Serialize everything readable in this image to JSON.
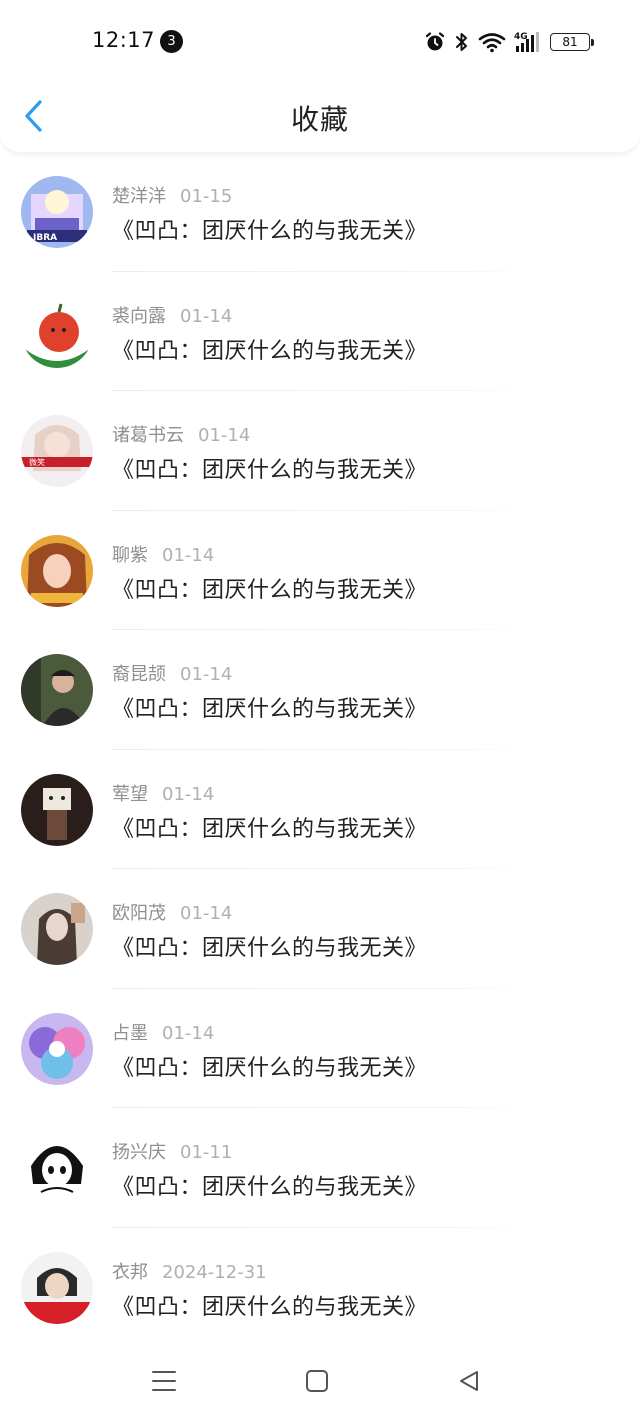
{
  "status_bar": {
    "time": "12:17",
    "notification_count": "3",
    "battery": "81",
    "network": "4G"
  },
  "header": {
    "title": "收藏"
  },
  "colors": {
    "accent": "#2a9df4",
    "name_text": "#8f8f8f",
    "date_text": "#b0b0b0",
    "title_text": "#222222"
  },
  "favorites": [
    {
      "name": "楚洋洋",
      "date": "01-15",
      "title": "《凹凸：团厌什么的与我无关》"
    },
    {
      "name": "裘向露",
      "date": "01-14",
      "title": "《凹凸：团厌什么的与我无关》"
    },
    {
      "name": "诸葛书云",
      "date": "01-14",
      "title": "《凹凸：团厌什么的与我无关》"
    },
    {
      "name": "聊紫",
      "date": "01-14",
      "title": "《凹凸：团厌什么的与我无关》"
    },
    {
      "name": "裔昆颉",
      "date": "01-14",
      "title": "《凹凸：团厌什么的与我无关》"
    },
    {
      "name": "荤望",
      "date": "01-14",
      "title": "《凹凸：团厌什么的与我无关》"
    },
    {
      "name": "欧阳茂",
      "date": "01-14",
      "title": "《凹凸：团厌什么的与我无关》"
    },
    {
      "name": "占墨",
      "date": "01-14",
      "title": "《凹凸：团厌什么的与我无关》"
    },
    {
      "name": "扬兴庆",
      "date": "01-11",
      "title": "《凹凸：团厌什么的与我无关》"
    },
    {
      "name": "衣邦",
      "date": "2024-12-31",
      "title": "《凹凸：团厌什么的与我无关》"
    }
  ],
  "nav": {
    "menu_icon": "menu-icon",
    "home_icon": "home-square-icon",
    "back_icon": "back-triangle-icon"
  }
}
